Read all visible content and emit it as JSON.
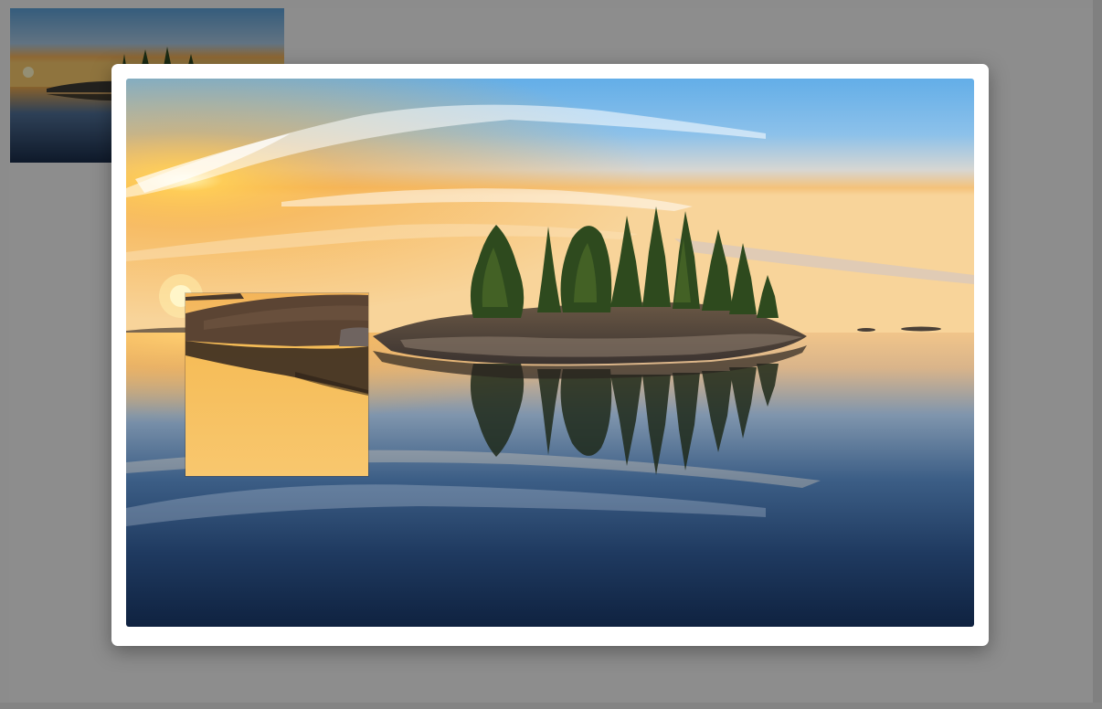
{
  "page": {
    "background_color": "#8c8c8c"
  },
  "thumbnail": {
    "subject": "island-lake-sunset-thumbnail"
  },
  "lightbox": {
    "panel_color": "#ffffff",
    "image": {
      "subject": "island-lake-sunset-photo"
    },
    "zoom_lens": {
      "subject": "zoomed-shoreline-detail"
    }
  }
}
